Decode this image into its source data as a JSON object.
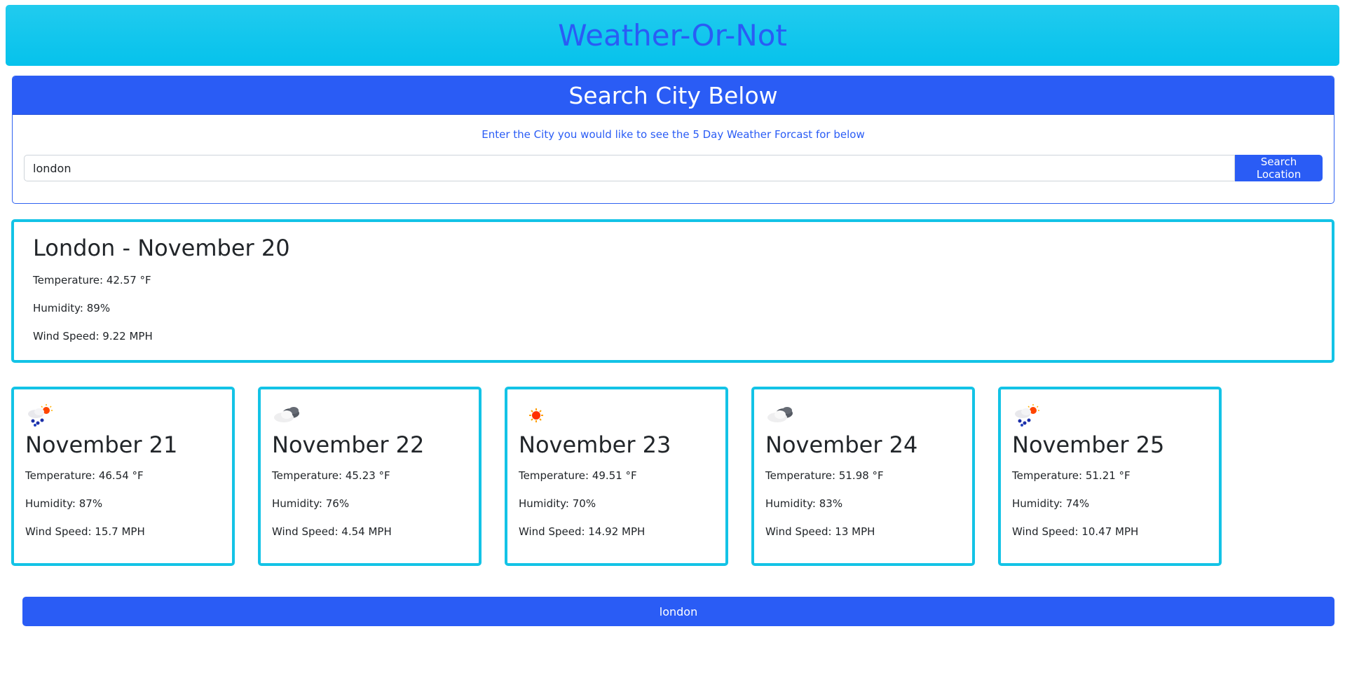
{
  "header": {
    "title": "Weather-Or-Not"
  },
  "search": {
    "heading": "Search City Below",
    "instructions": "Enter the City you would like to see the 5 Day Weather Forcast for below",
    "input_value": "london",
    "button_label": "Search Location"
  },
  "current": {
    "title": "London - November 20",
    "temperature": "Temperature: 42.57 °F",
    "humidity": "Humidity: 89%",
    "wind": "Wind Speed: 9.22 MPH"
  },
  "forecast": [
    {
      "icon": "rain-sun-icon",
      "date": "November 21",
      "temperature": "Temperature: 46.54 °F",
      "humidity": "Humidity: 87%",
      "wind": "Wind Speed: 15.7 MPH"
    },
    {
      "icon": "cloudy-icon",
      "date": "November 22",
      "temperature": "Temperature: 45.23 °F",
      "humidity": "Humidity: 76%",
      "wind": "Wind Speed: 4.54 MPH"
    },
    {
      "icon": "sun-icon",
      "date": "November 23",
      "temperature": "Temperature: 49.51 °F",
      "humidity": "Humidity: 70%",
      "wind": "Wind Speed: 14.92 MPH"
    },
    {
      "icon": "cloudy-icon",
      "date": "November 24",
      "temperature": "Temperature: 51.98 °F",
      "humidity": "Humidity: 83%",
      "wind": "Wind Speed: 13 MPH"
    },
    {
      "icon": "rain-sun-icon",
      "date": "November 25",
      "temperature": "Temperature: 51.21 °F",
      "humidity": "Humidity: 74%",
      "wind": "Wind Speed: 10.47 MPH"
    }
  ],
  "history": {
    "items": [
      "london"
    ]
  },
  "colors": {
    "header_bg": "#21cbee",
    "accent_blue": "#2a5cf5",
    "card_border": "#13c3e6"
  }
}
